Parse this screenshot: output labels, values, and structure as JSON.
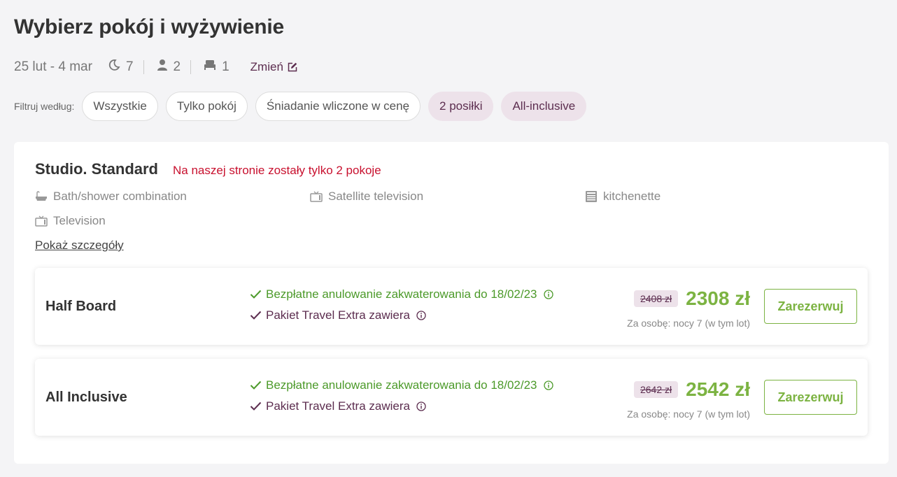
{
  "page": {
    "title": "Wybierz pokój i wyżywienie"
  },
  "summary": {
    "dates": "25 lut - 4 mar",
    "nights": "7",
    "persons": "2",
    "rooms": "1",
    "change_label": "Zmień",
    "icons": {
      "nights": "moon-icon",
      "persons": "person-icon",
      "rooms": "bed-icon",
      "change": "edit-icon"
    }
  },
  "filters": {
    "label": "Filtruj według:",
    "chips": [
      {
        "label": "Wszystkie",
        "active": false
      },
      {
        "label": "Tylko pokój",
        "active": false
      },
      {
        "label": "Śniadanie wliczone w cenę",
        "active": false
      },
      {
        "label": "2 posiłki",
        "active": true
      },
      {
        "label": "All-inclusive",
        "active": true
      }
    ]
  },
  "room": {
    "title": "Studio. Standard",
    "alert": "Na naszej stronie zostały tylko 2 pokoje",
    "amenities": [
      {
        "label": "Bath/shower combination",
        "icon": "bath-icon"
      },
      {
        "label": "Satellite television",
        "icon": "tv-icon"
      },
      {
        "label": "kitchenette",
        "icon": "kitchen-icon"
      },
      {
        "label": "Television",
        "icon": "tv-icon"
      }
    ],
    "details_link": "Pokaż szczegóły",
    "offers": [
      {
        "board": "Half Board",
        "cancellation": "Bezpłatne anulowanie zakwaterowania do 18/02/23",
        "package": "Pakiet Travel Extra zawiera",
        "old_price": "2408 zł",
        "price": "2308 zł",
        "per_person": "Za osobę: nocy 7 (w tym lot)",
        "book_label": "Zarezerwuj"
      },
      {
        "board": "All Inclusive",
        "cancellation": "Bezpłatne anulowanie zakwaterowania do 18/02/23",
        "package": "Pakiet Travel Extra zawiera",
        "old_price": "2642 zł",
        "price": "2542 zł",
        "per_person": "Za osobę: nocy 7 (w tym lot)",
        "book_label": "Zarezerwuj"
      }
    ]
  },
  "colors": {
    "accent_purple": "#5c2d4f",
    "accent_green": "#7cb342",
    "alert_red": "#c8102e",
    "chip_active_bg": "#ede2ea"
  }
}
